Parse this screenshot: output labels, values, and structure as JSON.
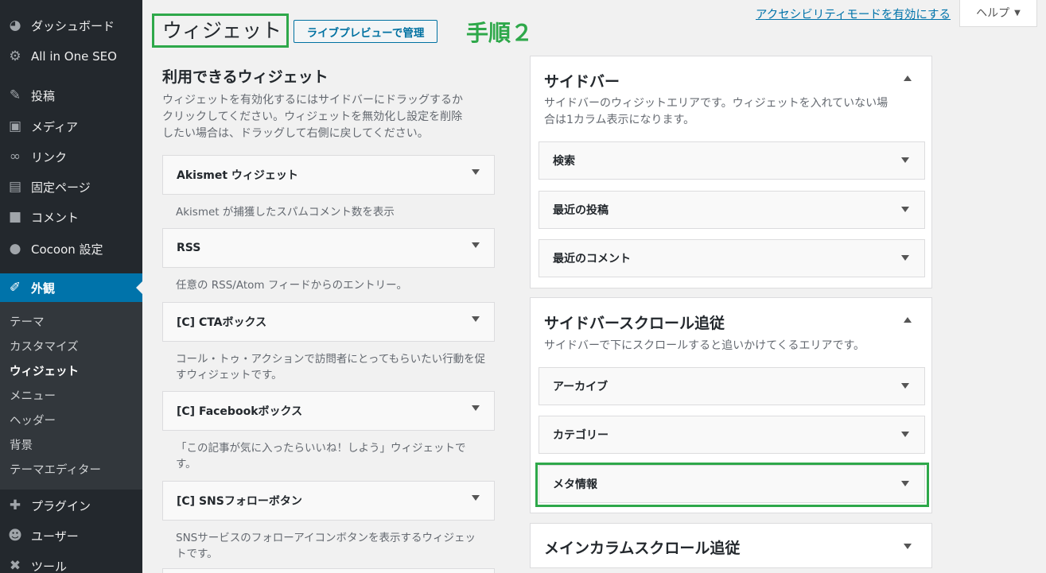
{
  "sidebar": {
    "items": [
      {
        "label": "ダッシュボード",
        "icon": "dashboard-icon"
      },
      {
        "label": "All in One SEO",
        "icon": "gear-icon"
      },
      {
        "label": "投稿",
        "icon": "pin-icon"
      },
      {
        "label": "メディア",
        "icon": "media-icon"
      },
      {
        "label": "リンク",
        "icon": "link-icon"
      },
      {
        "label": "固定ページ",
        "icon": "page-icon"
      },
      {
        "label": "コメント",
        "icon": "comment-icon"
      },
      {
        "label": "Cocoon 設定",
        "icon": "circle-icon"
      },
      {
        "label": "外観",
        "icon": "brush-icon"
      },
      {
        "label": "プラグイン",
        "icon": "plugin-icon"
      },
      {
        "label": "ユーザー",
        "icon": "user-icon"
      },
      {
        "label": "ツール",
        "icon": "wrench-icon"
      }
    ],
    "submenu": [
      "テーマ",
      "カスタマイズ",
      "ウィジェット",
      "メニュー",
      "ヘッダー",
      "背景",
      "テーマエディター"
    ]
  },
  "header": {
    "title": "ウィジェット",
    "action": "ライブプレビューで管理",
    "step": "手順２",
    "accessibility_link": "アクセシビリティモードを有効にする",
    "help": "ヘルプ"
  },
  "available": {
    "title": "利用できるウィジェット",
    "description": "ウィジェットを有効化するにはサイドバーにドラッグするかクリックしてください。ウィジェットを無効化し設定を削除したい場合は、ドラッグして右側に戻してください。",
    "widgets": [
      {
        "name": "Akismet ウィジェット",
        "desc": "Akismet が捕獲したスパムコメント数を表示"
      },
      {
        "name": "RSS",
        "desc": "任意の RSS/Atom フィードからのエントリー。"
      },
      {
        "name": "[C] CTAボックス",
        "desc": "コール・トゥ・アクションで訪問者にとってもらいたい行動を促すウィジェットです。"
      },
      {
        "name": "[C] Facebookボックス",
        "desc": "「この記事が気に入ったらいいね！しよう」ウィジェットです。"
      },
      {
        "name": "[C] SNSフォローボタン",
        "desc": "SNSサービスのフォローアイコンボタンを表示するウィジェットです。"
      }
    ]
  },
  "sidebars": [
    {
      "title": "サイドバー",
      "description": "サイドバーのウィジットエリアです。ウィジェットを入れていない場合は1カラム表示になります。",
      "widgets": [
        "検索",
        "最近の投稿",
        "最近のコメント"
      ]
    },
    {
      "title": "サイドバースクロール追従",
      "description": "サイドバーで下にスクロールすると追いかけてくるエリアです。",
      "widgets": [
        "アーカイブ",
        "カテゴリー",
        "メタ情報"
      ]
    },
    {
      "title": "メインカラムスクロール追従"
    }
  ],
  "colors": {
    "accent": "#0073aa",
    "highlight": "#2ea84a",
    "sidebar_bg": "#23282d"
  }
}
